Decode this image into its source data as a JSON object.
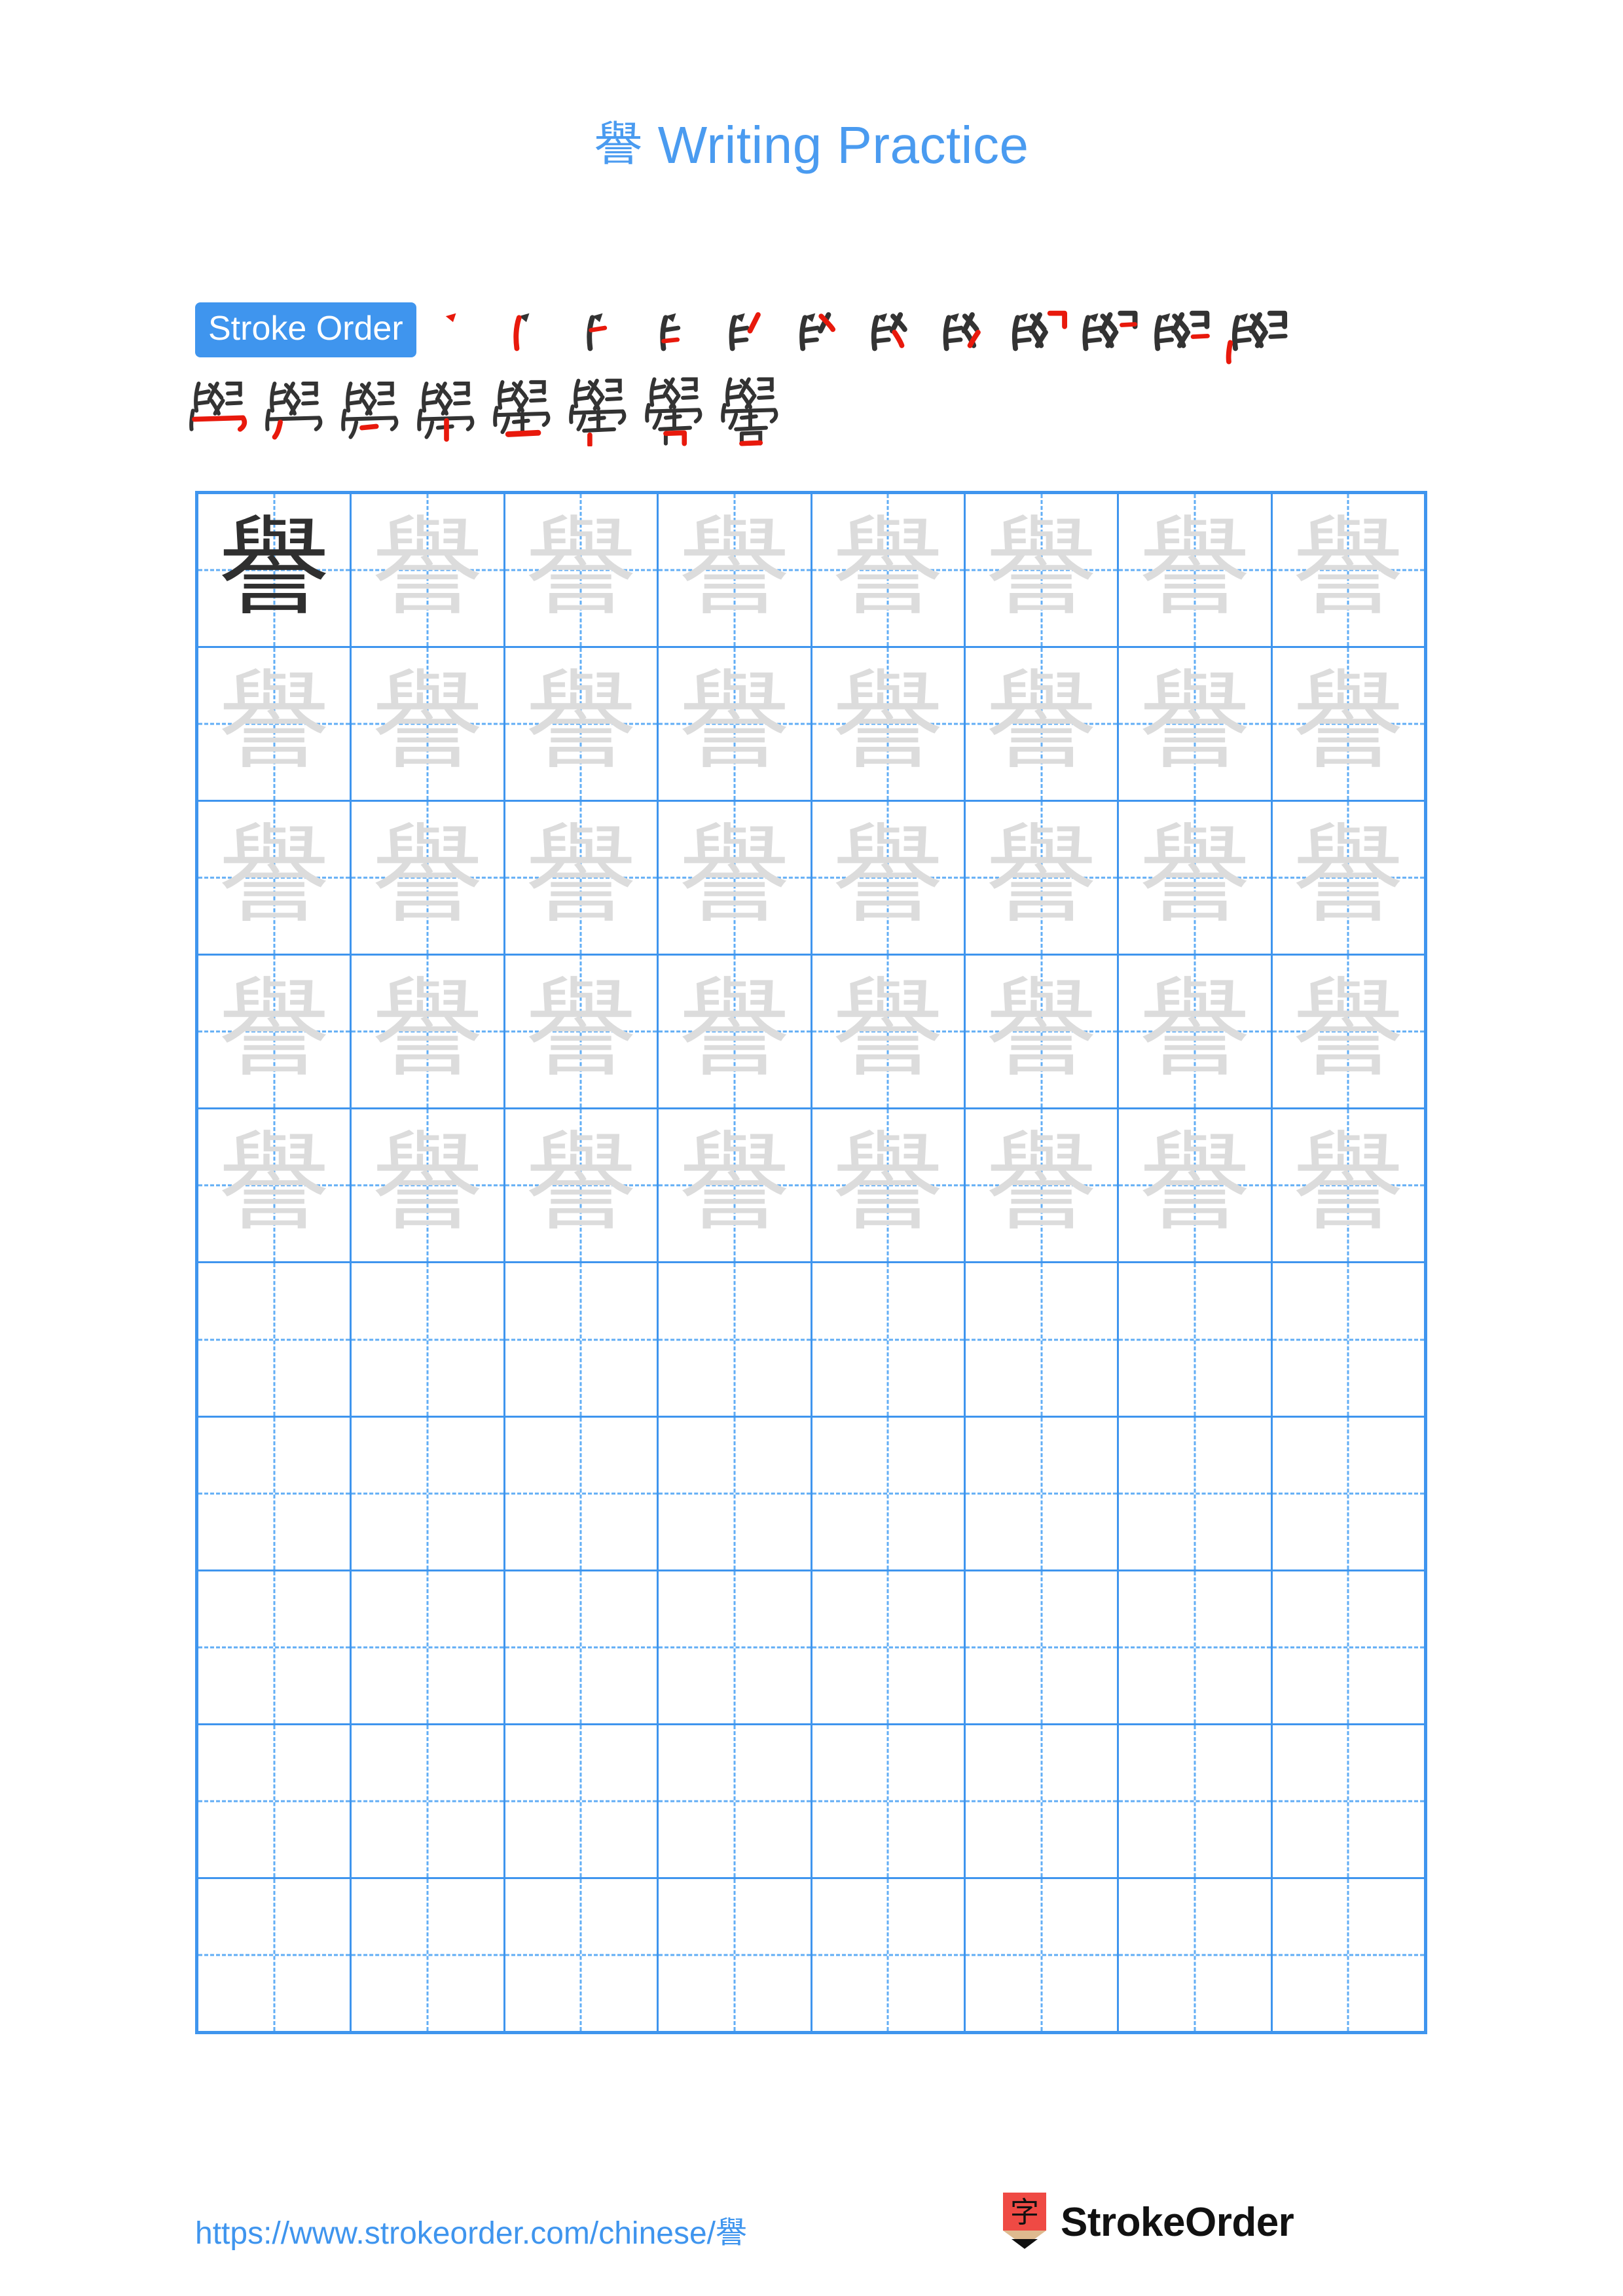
{
  "page": {
    "character": "譽",
    "title_suffix": " Writing Practice",
    "background_color": "#ffffff",
    "accent_color": "#3f95ee",
    "trace_color": "#dcdcdc",
    "ink_color": "#2f2f2f",
    "highlight_stroke_color": "#e8190c"
  },
  "stroke_order": {
    "badge_label": "Stroke Order",
    "total_strokes": 20,
    "row1_count": 12,
    "row2_count": 8,
    "row1_glyphs": [
      "丶",
      "亠",
      "⺊",
      "𠂆",
      "⺁",
      "⺈",
      "⺄",
      "⺆",
      "⺊",
      "⺌",
      "⺍",
      "⺅"
    ],
    "row2_glyphs": [
      "與",
      "與",
      "與",
      "舉",
      "舉",
      "譽",
      "譽",
      "譽"
    ]
  },
  "practice_grid": {
    "columns": 8,
    "rows": 10,
    "filled_rows": 5,
    "empty_rows": 5,
    "first_cell_style": "solid",
    "trace_style": "trace",
    "character": "譽"
  },
  "footer": {
    "url_prefix": "https://www.strokeorder.com/chinese/",
    "url_char": "譽",
    "logo_text": "StrokeOrder",
    "logo_char": "字",
    "logo_body_color": "#ef4a44",
    "logo_wood_color": "#deba8f",
    "logo_tip_color": "#111111"
  }
}
